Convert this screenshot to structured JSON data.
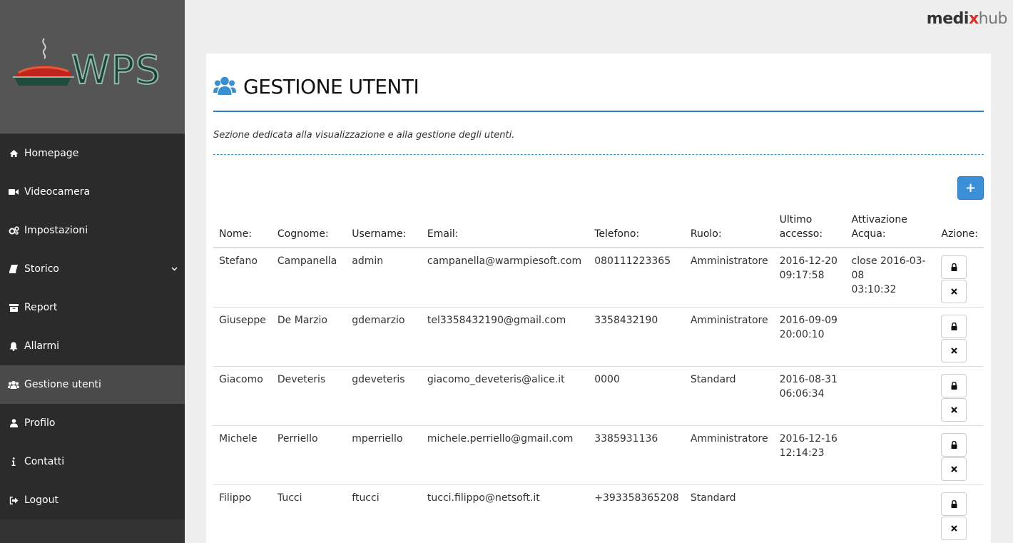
{
  "brand": {
    "part1": "medi",
    "part2": "x",
    "part3": "hub"
  },
  "logo": {
    "text": "WPS"
  },
  "sidebar": {
    "items": [
      {
        "label": "Homepage",
        "icon": "home-icon"
      },
      {
        "label": "Videocamera",
        "icon": "video-icon"
      },
      {
        "label": "Impostazioni",
        "icon": "gears-icon"
      },
      {
        "label": "Storico",
        "icon": "book-icon",
        "has_caret": true
      },
      {
        "label": "Report",
        "icon": "archive-icon"
      },
      {
        "label": "Allarmi",
        "icon": "bell-icon"
      },
      {
        "label": "Gestione utenti",
        "icon": "users-icon",
        "active": true
      },
      {
        "label": "Profilo",
        "icon": "user-icon"
      },
      {
        "label": "Contatti",
        "icon": "info-icon"
      },
      {
        "label": "Logout",
        "icon": "sign-out-icon"
      }
    ]
  },
  "page": {
    "title": "GESTIONE UTENTI",
    "subtitle": "Sezione dedicata alla visualizzazione e alla gestione degli utenti.",
    "add_button": "+"
  },
  "table": {
    "headers": {
      "nome": "Nome:",
      "cognome": "Cognome:",
      "username": "Username:",
      "email": "Email:",
      "telefono": "Telefono:",
      "ruolo": "Ruolo:",
      "ultimo_1": "Ultimo",
      "ultimo_2": "accesso:",
      "attivazione": "Attivazione Acqua:",
      "azione": "Azione:"
    },
    "rows": [
      {
        "nome": "Stefano",
        "cognome": "Campanella",
        "username": "admin",
        "email": "campanella@warmpiesoft.com",
        "telefono": "080111223365",
        "ruolo": "Amministratore",
        "accesso_data": "2016-12-20",
        "accesso_ora": "09:17:58",
        "attiv_1": "close 2016-03-08",
        "attiv_2": "03:10:32"
      },
      {
        "nome": "Giuseppe",
        "cognome": "De Marzio",
        "username": "gdemarzio",
        "email": "tel3358432190@gmail.com",
        "telefono": "3358432190",
        "ruolo": "Amministratore",
        "accesso_data": "2016-09-09",
        "accesso_ora": "20:00:10",
        "attiv_1": "",
        "attiv_2": ""
      },
      {
        "nome": "Giacomo",
        "cognome": "Deveteris",
        "username": "gdeveteris",
        "email": "giacomo_deveteris@alice.it",
        "telefono": "0000",
        "ruolo": "Standard",
        "accesso_data": "2016-08-31",
        "accesso_ora": "06:06:34",
        "attiv_1": "",
        "attiv_2": ""
      },
      {
        "nome": "Michele",
        "cognome": "Perriello",
        "username": "mperriello",
        "email": "michele.perriello@gmail.com",
        "telefono": "3385931136",
        "ruolo": "Amministratore",
        "accesso_data": "2016-12-16",
        "accesso_ora": "12:14:23",
        "attiv_1": "",
        "attiv_2": ""
      },
      {
        "nome": "Filippo",
        "cognome": "Tucci",
        "username": "ftucci",
        "email": "tucci.filippo@netsoft.it",
        "telefono": "+393358365208",
        "ruolo": "Standard",
        "accesso_data": "",
        "accesso_ora": "",
        "attiv_1": "",
        "attiv_2": ""
      }
    ]
  }
}
